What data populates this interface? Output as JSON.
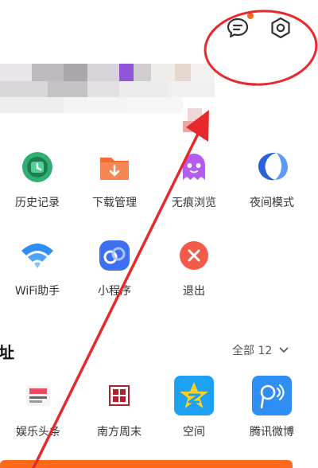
{
  "header": {
    "message_icon": "message-bubble-icon",
    "settings_icon": "hexagon-settings-icon",
    "badge_color": "#ff6a1a"
  },
  "menu": [
    {
      "label": "历史记录",
      "icon": "clock-icon",
      "color": "#2fb072"
    },
    {
      "label": "下载管理",
      "icon": "download-folder-icon",
      "color": "#f56a35"
    },
    {
      "label": "无痕浏览",
      "icon": "ghost-icon",
      "color": "#b45cf0"
    },
    {
      "label": "夜间模式",
      "icon": "moon-icon",
      "color": "#3b7af5"
    },
    {
      "label": "WiFi助手",
      "icon": "wifi-icon",
      "color": "#2f8ef5"
    },
    {
      "label": "小程序",
      "icon": "mini-program-icon",
      "color": "#3d6ff0"
    },
    {
      "label": "退出",
      "icon": "close-circle-icon",
      "color": "#f45a4a"
    }
  ],
  "section": {
    "title": "址",
    "all_label": "全部 12"
  },
  "apps": [
    {
      "label": "娱乐头条",
      "icon": "news-logo-icon"
    },
    {
      "label": "南方周末",
      "icon": "nanfang-logo-icon"
    },
    {
      "label": "空间",
      "icon": "qzone-star-icon",
      "color": "#1da1f2"
    },
    {
      "label": "腾讯微博",
      "icon": "tencent-weibo-icon",
      "color": "#2f8ef5"
    }
  ],
  "annotation_color": "#e8292c"
}
